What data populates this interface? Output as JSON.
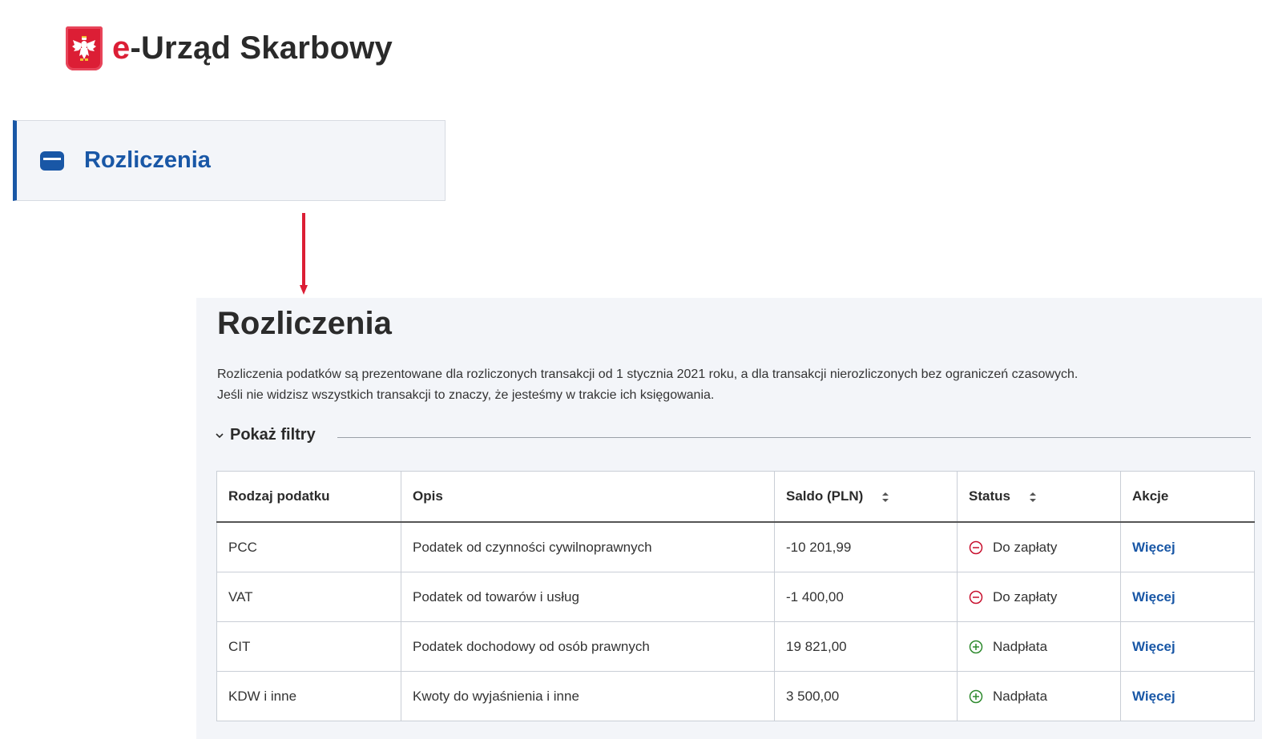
{
  "header": {
    "logo_prefix": "e",
    "logo_rest": "-Urząd Skarbowy",
    "brand_red": "#dc1e35"
  },
  "nav": {
    "active_item": {
      "label": "Rozliczenia",
      "icon": "wallet-card-icon"
    },
    "accent_color": "#1957a6"
  },
  "main": {
    "title": "Rozliczenia",
    "description_line1": "Rozliczenia podatków są prezentowane dla rozliczonych transakcji od 1 stycznia 2021 roku, a dla transakcji nierozliczonych bez ograniczeń czasowych.",
    "description_line2": "Jeśli nie widzisz wszystkich transakcji to znaczy, że jesteśmy w trakcie ich księgowania.",
    "filters_label": "Pokaż filtry",
    "table": {
      "headers": {
        "type": "Rodzaj podatku",
        "description": "Opis",
        "balance": "Saldo (PLN)",
        "status": "Status",
        "actions": "Akcje"
      },
      "rows": [
        {
          "type": "PCC",
          "description": "Podatek od czynności cywilnoprawnych",
          "balance": "-10 201,99",
          "status": "Do zapłaty",
          "status_icon": "minus-circle-icon",
          "action": "Więcej"
        },
        {
          "type": "VAT",
          "description": "Podatek od towarów i usług",
          "balance": "-1 400,00",
          "status": "Do zapłaty",
          "status_icon": "minus-circle-icon",
          "action": "Więcej"
        },
        {
          "type": "CIT",
          "description": "Podatek dochodowy od osób prawnych",
          "balance": "19 821,00",
          "status": "Nadpłata",
          "status_icon": "plus-circle-icon",
          "action": "Więcej"
        },
        {
          "type": "KDW i inne",
          "description": "Kwoty do wyjaśnienia i inne",
          "balance": "3 500,00",
          "status": "Nadpłata",
          "status_icon": "plus-circle-icon",
          "action": "Więcej"
        }
      ]
    },
    "colors": {
      "negative": "#c8102e",
      "positive": "#2e8a2e",
      "link": "#1957a6"
    }
  }
}
